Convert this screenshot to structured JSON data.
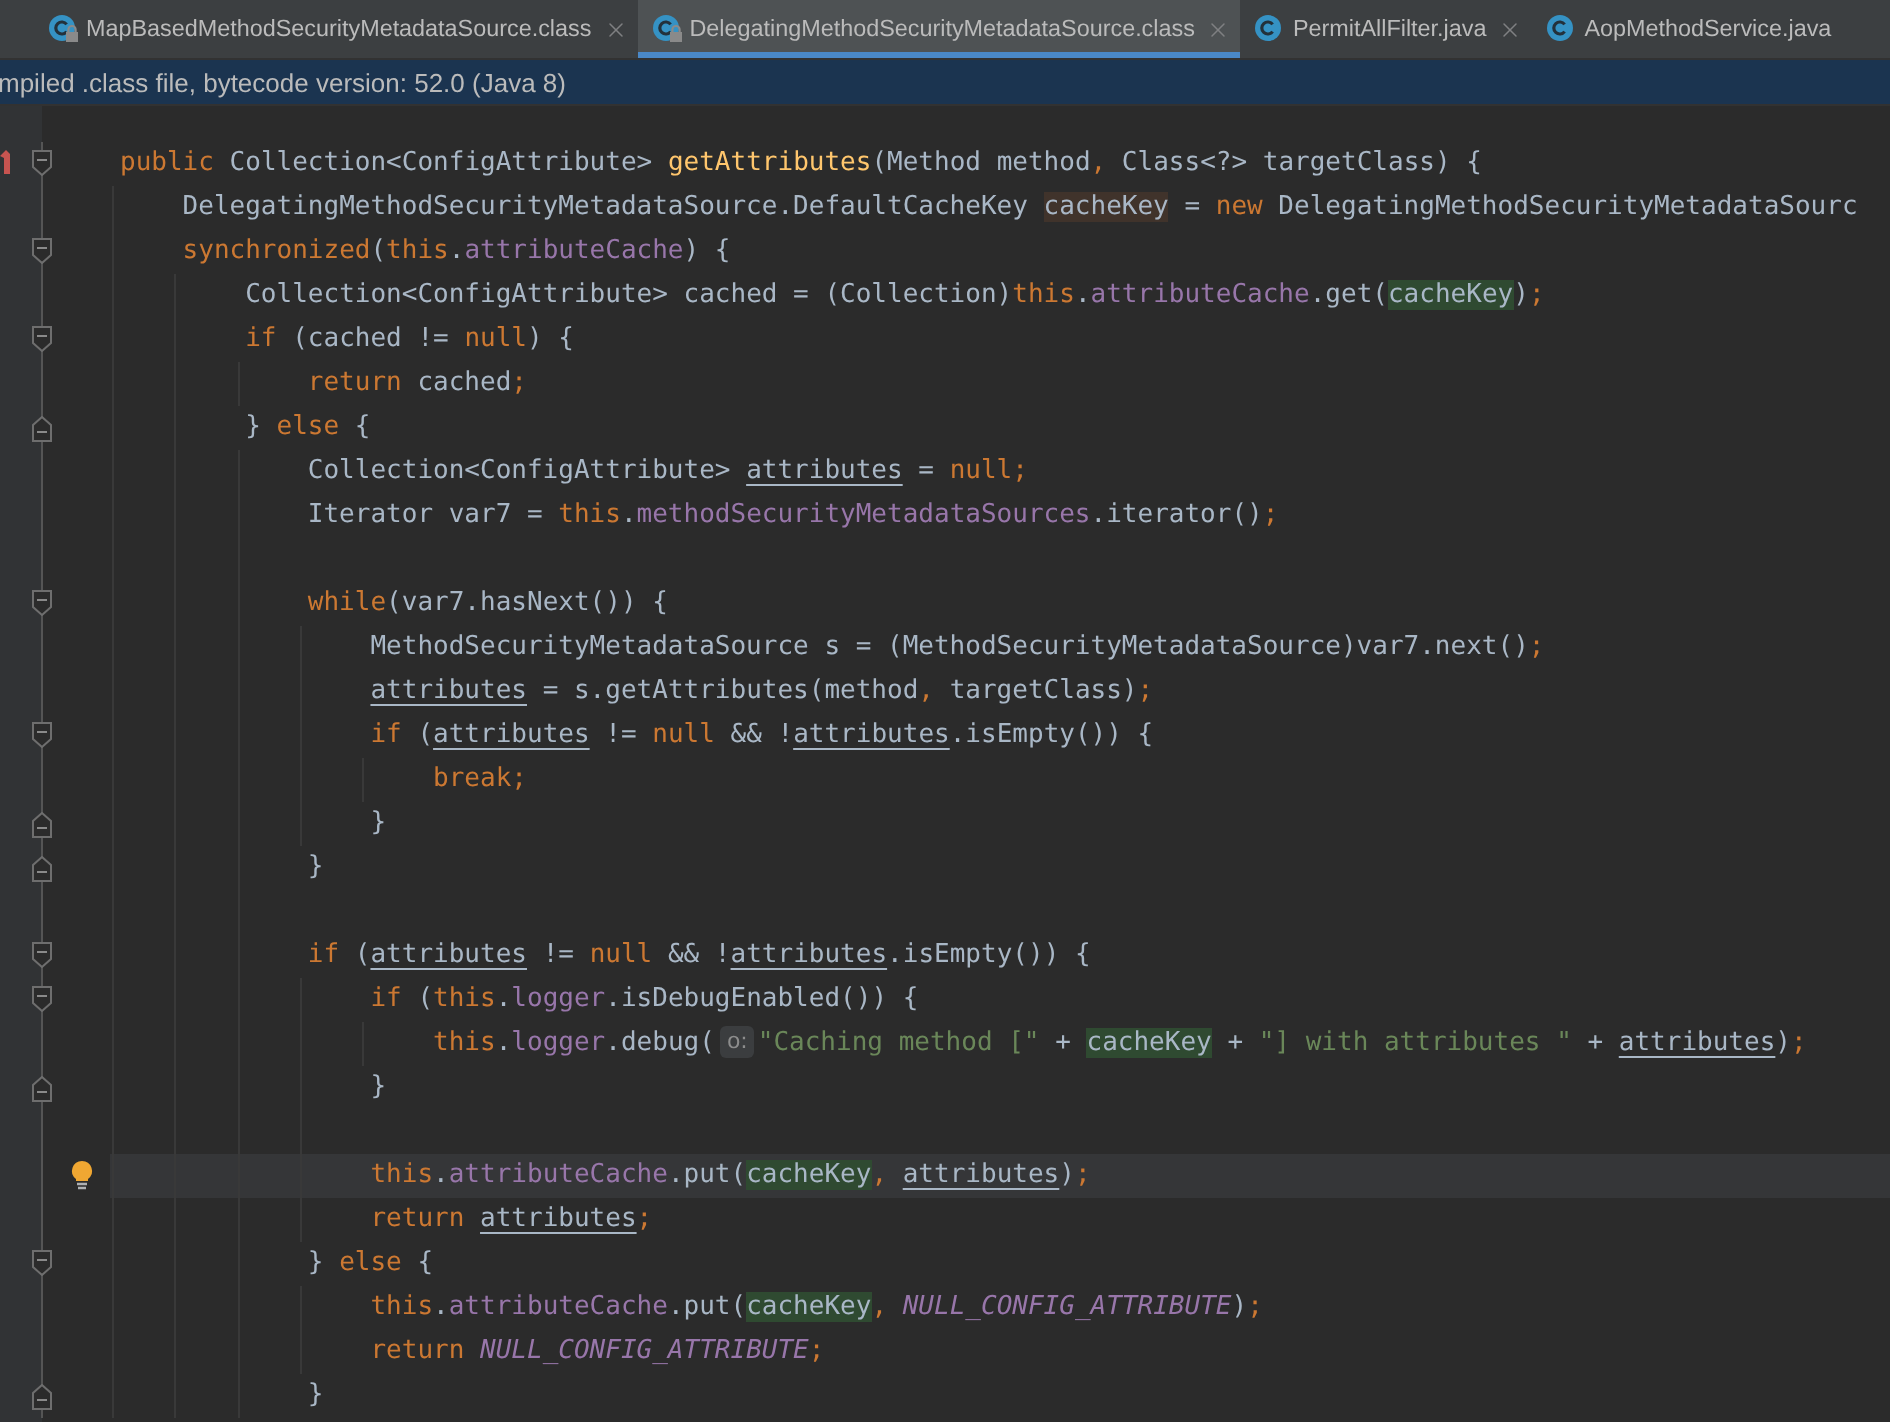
{
  "tabs": [
    {
      "label": "MapBasedMethodSecurityMetadataSource.class",
      "selected": false,
      "locked": true,
      "closable": true
    },
    {
      "label": "DelegatingMethodSecurityMetadataSource.class",
      "selected": true,
      "locked": true,
      "closable": true
    },
    {
      "label": "PermitAllFilter.java",
      "selected": false,
      "locked": false,
      "closable": true
    },
    {
      "label": "AopMethodService.java",
      "selected": false,
      "locked": false,
      "closable": false
    }
  ],
  "notification": {
    "text": "mpiled .class file, bytecode version: 52.0 (Java 8)"
  },
  "editor": {
    "lines": [
      {
        "kind": "code",
        "fold_start": true,
        "override": true,
        "current": false,
        "tokens": [
          {
            "text": "public",
            "kind": "kw"
          },
          {
            "text": " Collection<ConfigAttribute> ",
            "kind": "plain"
          },
          {
            "text": "getAttributes",
            "kind": "method"
          },
          {
            "text": "(Method method",
            "kind": "plain"
          },
          {
            "text": ",",
            "kind": "kw"
          },
          {
            "text": " Class<?> targetClass) {",
            "kind": "plain"
          }
        ],
        "children": [
          {
            "kind": "code",
            "current": false,
            "tokens": [
              {
                "text": "DelegatingMethodSecurityMetadataSource.DefaultCacheKey ",
                "kind": "plain"
              },
              {
                "text": "cacheKey",
                "kind": "plain",
                "declaration": true
              },
              {
                "text": " = ",
                "kind": "plain"
              },
              {
                "text": "new",
                "kind": "kw"
              },
              {
                "text": " DelegatingMethodSecurityMetadataSourc",
                "kind": "plain"
              }
            ]
          },
          {
            "kind": "code",
            "fold_start": true,
            "current": false,
            "tokens": [
              {
                "text": "synchronized",
                "kind": "kw"
              },
              {
                "text": "(",
                "kind": "plain"
              },
              {
                "text": "this",
                "kind": "kw"
              },
              {
                "text": ".",
                "kind": "plain"
              },
              {
                "text": "attributeCache",
                "kind": "field"
              },
              {
                "text": ") {",
                "kind": "plain"
              }
            ],
            "children": [
              {
                "kind": "code",
                "current": false,
                "tokens": [
                  {
                    "text": "Collection<ConfigAttribute> cached = (Collection)",
                    "kind": "plain"
                  },
                  {
                    "text": "this",
                    "kind": "kw"
                  },
                  {
                    "text": ".",
                    "kind": "plain"
                  },
                  {
                    "text": "attributeCache",
                    "kind": "field"
                  },
                  {
                    "text": ".get(",
                    "kind": "plain"
                  },
                  {
                    "text": "cacheKey",
                    "kind": "plain",
                    "highlighted": true
                  },
                  {
                    "text": ")",
                    "kind": "plain"
                  },
                  {
                    "text": ";",
                    "kind": "kw"
                  }
                ]
              },
              {
                "kind": "code",
                "fold_start": true,
                "current": false,
                "tokens": [
                  {
                    "text": "if",
                    "kind": "kw"
                  },
                  {
                    "text": " (cached != ",
                    "kind": "plain"
                  },
                  {
                    "text": "null",
                    "kind": "kw"
                  },
                  {
                    "text": ") {",
                    "kind": "plain"
                  }
                ],
                "children": [
                  {
                    "kind": "code",
                    "current": false,
                    "tokens": [
                      {
                        "text": "return",
                        "kind": "kw"
                      },
                      {
                        "text": " cached",
                        "kind": "plain"
                      },
                      {
                        "text": ";",
                        "kind": "kw"
                      }
                    ]
                  }
                ]
              },
              {
                "kind": "code",
                "fold_end": true,
                "current": false,
                "tokens": [
                  {
                    "text": "} ",
                    "kind": "plain"
                  },
                  {
                    "text": "else",
                    "kind": "kw"
                  },
                  {
                    "text": " {",
                    "kind": "plain"
                  }
                ],
                "children": [
                  {
                    "kind": "code",
                    "current": false,
                    "tokens": [
                      {
                        "text": "Collection<ConfigAttribute> ",
                        "kind": "plain"
                      },
                      {
                        "text": "attributes",
                        "kind": "plain",
                        "underline": true
                      },
                      {
                        "text": " = ",
                        "kind": "plain"
                      },
                      {
                        "text": "null",
                        "kind": "kw"
                      },
                      {
                        "text": ";",
                        "kind": "kw"
                      }
                    ]
                  },
                  {
                    "kind": "code",
                    "current": false,
                    "tokens": [
                      {
                        "text": "Iterator var7 = ",
                        "kind": "plain"
                      },
                      {
                        "text": "this",
                        "kind": "kw"
                      },
                      {
                        "text": ".",
                        "kind": "plain"
                      },
                      {
                        "text": "methodSecurityMetadataSources",
                        "kind": "field"
                      },
                      {
                        "text": ".iterator()",
                        "kind": "plain"
                      },
                      {
                        "text": ";",
                        "kind": "kw"
                      }
                    ]
                  },
                  {
                    "kind": "blank",
                    "current": false
                  },
                  {
                    "kind": "code",
                    "fold_start": true,
                    "current": false,
                    "tokens": [
                      {
                        "text": "while",
                        "kind": "kw"
                      },
                      {
                        "text": "(var7.hasNext()) {",
                        "kind": "plain"
                      }
                    ],
                    "children": [
                      {
                        "kind": "code",
                        "current": false,
                        "tokens": [
                          {
                            "text": "MethodSecurityMetadataSource s = (MethodSecurityMetadataSource)var7.next()",
                            "kind": "plain"
                          },
                          {
                            "text": ";",
                            "kind": "kw"
                          }
                        ]
                      },
                      {
                        "kind": "code",
                        "current": false,
                        "tokens": [
                          {
                            "text": "attributes",
                            "kind": "plain",
                            "underline": true
                          },
                          {
                            "text": " = s.getAttributes(method",
                            "kind": "plain"
                          },
                          {
                            "text": ",",
                            "kind": "kw"
                          },
                          {
                            "text": " targetClass)",
                            "kind": "plain"
                          },
                          {
                            "text": ";",
                            "kind": "kw"
                          }
                        ]
                      },
                      {
                        "kind": "code",
                        "fold_start": true,
                        "current": false,
                        "tokens": [
                          {
                            "text": "if",
                            "kind": "kw"
                          },
                          {
                            "text": " (",
                            "kind": "plain"
                          },
                          {
                            "text": "attributes",
                            "kind": "plain",
                            "underline": true
                          },
                          {
                            "text": " != ",
                            "kind": "plain"
                          },
                          {
                            "text": "null",
                            "kind": "kw"
                          },
                          {
                            "text": " && !",
                            "kind": "plain"
                          },
                          {
                            "text": "attributes",
                            "kind": "plain",
                            "underline": true
                          },
                          {
                            "text": ".isEmpty()) {",
                            "kind": "plain"
                          }
                        ],
                        "children": [
                          {
                            "kind": "code",
                            "current": false,
                            "tokens": [
                              {
                                "text": "break",
                                "kind": "kw"
                              },
                              {
                                "text": ";",
                                "kind": "kw"
                              }
                            ]
                          }
                        ]
                      },
                      {
                        "kind": "code",
                        "fold_end": true,
                        "current": false,
                        "tokens": [
                          {
                            "text": "}",
                            "kind": "plain"
                          }
                        ]
                      }
                    ]
                  },
                  {
                    "kind": "code",
                    "fold_end": true,
                    "current": false,
                    "tokens": [
                      {
                        "text": "}",
                        "kind": "plain"
                      }
                    ]
                  },
                  {
                    "kind": "blank",
                    "current": false
                  },
                  {
                    "kind": "code",
                    "fold_start": true,
                    "current": false,
                    "tokens": [
                      {
                        "text": "if",
                        "kind": "kw"
                      },
                      {
                        "text": " (",
                        "kind": "plain"
                      },
                      {
                        "text": "attributes",
                        "kind": "plain",
                        "underline": true
                      },
                      {
                        "text": " != ",
                        "kind": "plain"
                      },
                      {
                        "text": "null",
                        "kind": "kw"
                      },
                      {
                        "text": " && !",
                        "kind": "plain"
                      },
                      {
                        "text": "attributes",
                        "kind": "plain",
                        "underline": true
                      },
                      {
                        "text": ".isEmpty()) {",
                        "kind": "plain"
                      }
                    ],
                    "children": [
                      {
                        "kind": "code",
                        "fold_start": true,
                        "current": false,
                        "tokens": [
                          {
                            "text": "if",
                            "kind": "kw"
                          },
                          {
                            "text": " (",
                            "kind": "plain"
                          },
                          {
                            "text": "this",
                            "kind": "kw"
                          },
                          {
                            "text": ".",
                            "kind": "plain"
                          },
                          {
                            "text": "logger",
                            "kind": "field"
                          },
                          {
                            "text": ".isDebugEnabled()) {",
                            "kind": "plain"
                          }
                        ],
                        "children": [
                          {
                            "kind": "code",
                            "current": false,
                            "tokens": [
                              {
                                "text": "this",
                                "kind": "kw"
                              },
                              {
                                "text": ".",
                                "kind": "plain"
                              },
                              {
                                "text": "logger",
                                "kind": "field"
                              },
                              {
                                "text": ".debug(",
                                "kind": "plain"
                              },
                              {
                                "text": "o:",
                                "kind": "hint"
                              },
                              {
                                "text": "\"Caching method [\"",
                                "kind": "str"
                              },
                              {
                                "text": " + ",
                                "kind": "plain"
                              },
                              {
                                "text": "cacheKey",
                                "kind": "plain",
                                "highlighted": true
                              },
                              {
                                "text": " + ",
                                "kind": "plain"
                              },
                              {
                                "text": "\"] with attributes \"",
                                "kind": "str"
                              },
                              {
                                "text": " + ",
                                "kind": "plain"
                              },
                              {
                                "text": "attributes",
                                "kind": "plain",
                                "underline": true
                              },
                              {
                                "text": ")",
                                "kind": "plain"
                              },
                              {
                                "text": ";",
                                "kind": "kw"
                              }
                            ]
                          }
                        ]
                      },
                      {
                        "kind": "code",
                        "fold_end": true,
                        "current": false,
                        "tokens": [
                          {
                            "text": "}",
                            "kind": "plain"
                          }
                        ]
                      },
                      {
                        "kind": "blank",
                        "current": false
                      },
                      {
                        "kind": "code",
                        "bulb": true,
                        "current": true,
                        "tokens": [
                          {
                            "text": "this",
                            "kind": "kw"
                          },
                          {
                            "text": ".",
                            "kind": "plain"
                          },
                          {
                            "text": "attributeCache",
                            "kind": "field"
                          },
                          {
                            "text": ".put(",
                            "kind": "plain"
                          },
                          {
                            "text": "cacheKey",
                            "kind": "plain",
                            "highlighted": true
                          },
                          {
                            "text": ", ",
                            "kind": "kw"
                          },
                          {
                            "text": "attributes",
                            "kind": "plain",
                            "underline": true
                          },
                          {
                            "text": ")",
                            "kind": "plain"
                          },
                          {
                            "text": ";",
                            "kind": "kw"
                          }
                        ]
                      },
                      {
                        "kind": "code",
                        "current": false,
                        "tokens": [
                          {
                            "text": "return ",
                            "kind": "kw"
                          },
                          {
                            "text": "attributes",
                            "kind": "plain",
                            "underline": true
                          },
                          {
                            "text": ";",
                            "kind": "kw"
                          }
                        ]
                      }
                    ]
                  },
                  {
                    "kind": "code",
                    "fold_start": true,
                    "current": false,
                    "tokens": [
                      {
                        "text": "} ",
                        "kind": "plain"
                      },
                      {
                        "text": "else",
                        "kind": "kw"
                      },
                      {
                        "text": " {",
                        "kind": "plain"
                      }
                    ],
                    "children": [
                      {
                        "kind": "code",
                        "current": false,
                        "tokens": [
                          {
                            "text": "this",
                            "kind": "kw"
                          },
                          {
                            "text": ".",
                            "kind": "plain"
                          },
                          {
                            "text": "attributeCache",
                            "kind": "field"
                          },
                          {
                            "text": ".put(",
                            "kind": "plain"
                          },
                          {
                            "text": "cacheKey",
                            "kind": "plain",
                            "highlighted": true
                          },
                          {
                            "text": ", ",
                            "kind": "kw"
                          },
                          {
                            "text": "NULL_CONFIG_ATTRIBUTE",
                            "kind": "const"
                          },
                          {
                            "text": ")",
                            "kind": "plain"
                          },
                          {
                            "text": ";",
                            "kind": "kw"
                          }
                        ]
                      },
                      {
                        "kind": "code",
                        "current": false,
                        "tokens": [
                          {
                            "text": "return ",
                            "kind": "kw"
                          },
                          {
                            "text": "NULL_CONFIG_ATTRIBUTE",
                            "kind": "const"
                          },
                          {
                            "text": ";",
                            "kind": "kw"
                          }
                        ]
                      }
                    ]
                  },
                  {
                    "kind": "code",
                    "fold_end": true,
                    "current": false,
                    "tokens": [
                      {
                        "text": "}",
                        "kind": "plain"
                      }
                    ]
                  }
                ]
              }
            ]
          }
        ]
      }
    ]
  }
}
